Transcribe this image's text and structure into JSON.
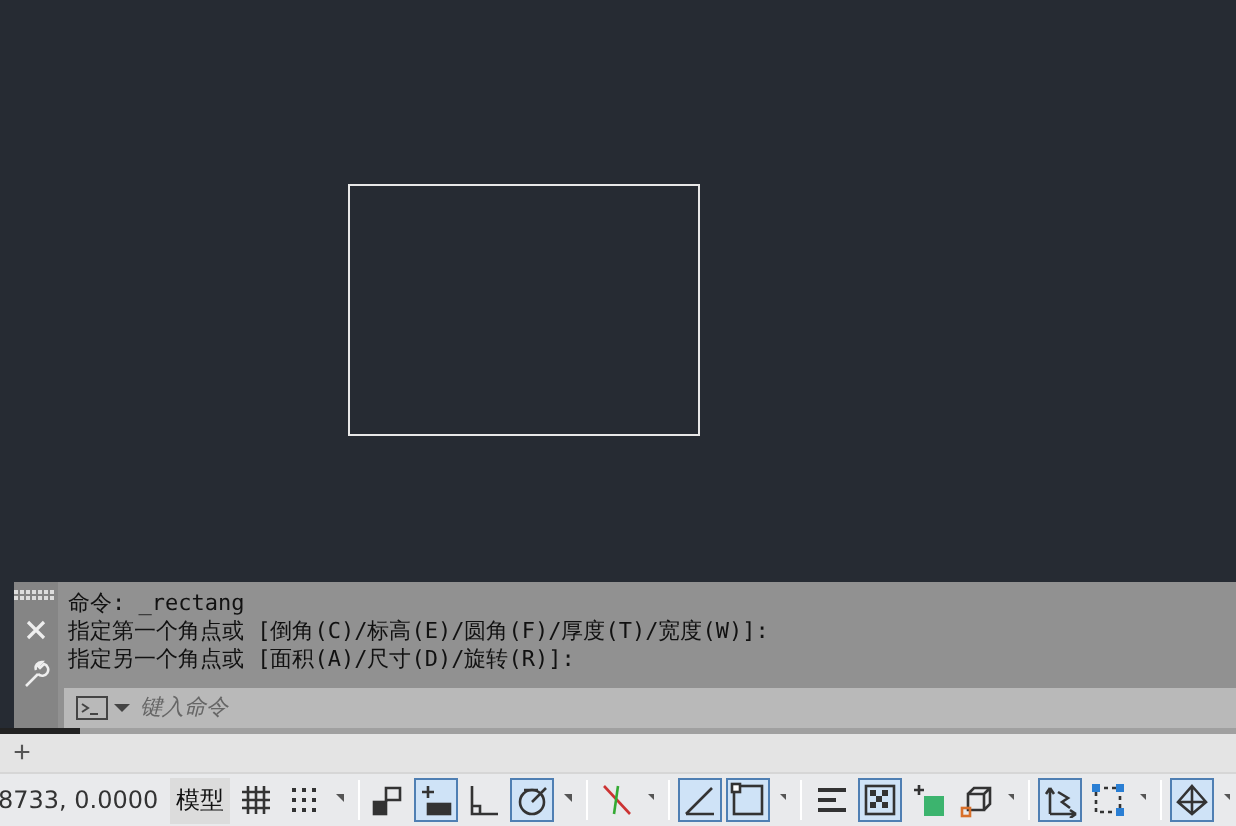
{
  "command_window": {
    "history": [
      "命令: _rectang",
      "指定第一个角点或 [倒角(C)/标高(E)/圆角(F)/厚度(T)/宽度(W)]:",
      "指定另一个角点或 [面积(A)/尺寸(D)/旋转(R)]:"
    ],
    "input": {
      "placeholder": "键入命令"
    }
  },
  "layout_tabs": {
    "add": "+"
  },
  "status_bar": {
    "coordinates": "8733, 0.0000",
    "model": "模型",
    "items": [
      {
        "kind": "toggle",
        "on": false
      },
      {
        "kind": "toggle",
        "on": false
      },
      {
        "kind": "caret"
      },
      {
        "kind": "toggle",
        "on": false
      },
      {
        "kind": "toggle",
        "on": true
      },
      {
        "kind": "toggle",
        "on": false
      },
      {
        "kind": "toggle",
        "on": true
      },
      {
        "kind": "caret"
      },
      {
        "kind": "toggle",
        "on": false
      },
      {
        "kind": "caret"
      },
      {
        "kind": "toggle",
        "on": true
      },
      {
        "kind": "toggle",
        "on": true
      },
      {
        "kind": "caret"
      },
      {
        "kind": "toggle",
        "on": false
      },
      {
        "kind": "toggle",
        "on": true
      },
      {
        "kind": "toggle",
        "on": false
      },
      {
        "kind": "toggle",
        "on": false
      },
      {
        "kind": "caret"
      },
      {
        "kind": "toggle",
        "on": true
      },
      {
        "kind": "toggle",
        "on": false
      },
      {
        "kind": "caret"
      },
      {
        "kind": "toggle",
        "on": true
      },
      {
        "kind": "caret"
      }
    ]
  }
}
